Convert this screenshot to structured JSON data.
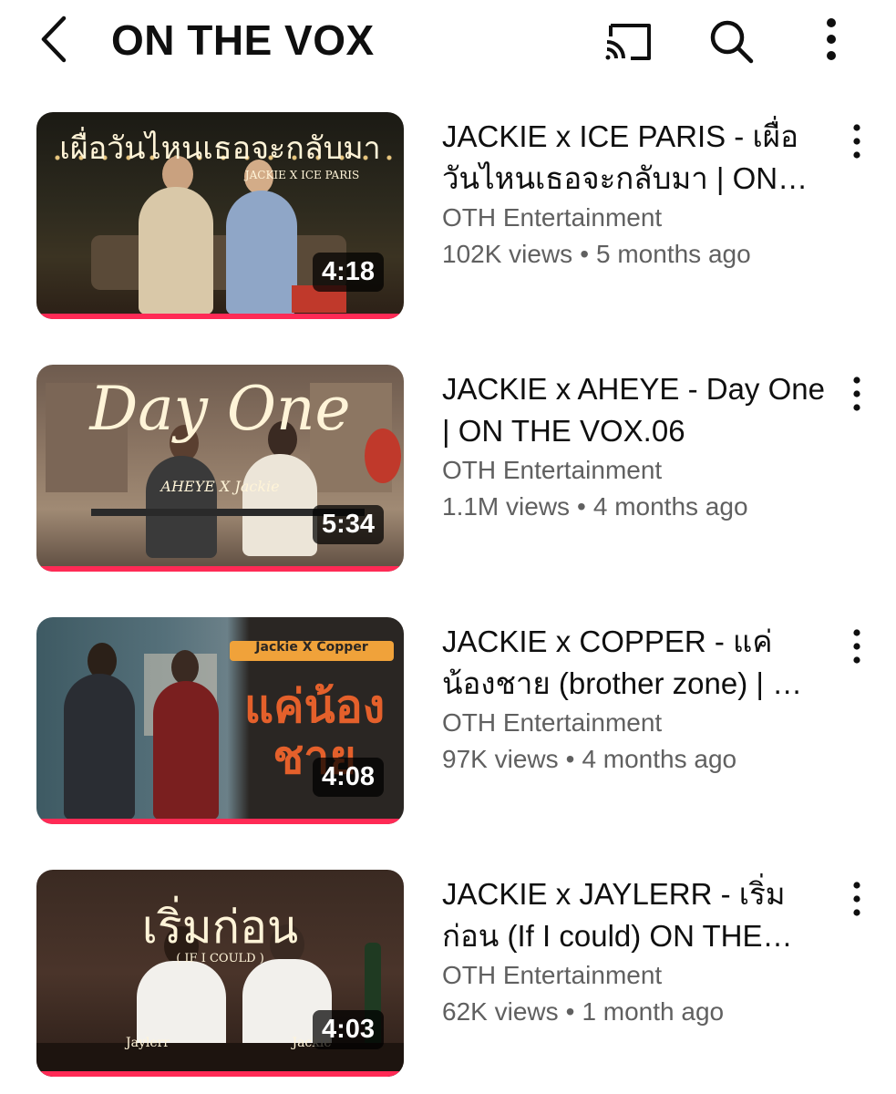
{
  "header": {
    "title": "ON THE VOX",
    "icons": [
      "back-icon",
      "cast-icon",
      "search-icon",
      "more-vert-icon"
    ]
  },
  "colors": {
    "progress": "#ff2a55",
    "secondary_text": "#606060"
  },
  "videos": [
    {
      "thumb_text": "เผื่อวันไหนเธอจะกลับมา",
      "thumb_sub": "JACKIE X ICE PARIS",
      "duration": "4:18",
      "watched": 1.0,
      "title": "JACKIE x ICE PARIS - เผื่อวันไหนเธอจะกลับมา | ON THE VOX",
      "channel": "OTH Entertainment",
      "views": "102K views",
      "age": "5 months ago"
    },
    {
      "thumb_text": "Day One",
      "thumb_sub": "AHEYE X Jackie",
      "duration": "5:34",
      "watched": 1.0,
      "title": "JACKIE x AHEYE - Day One | ON THE VOX.06",
      "channel": "OTH Entertainment",
      "views": "1.1M views",
      "age": "4 months ago"
    },
    {
      "thumb_text": "แค่น้องชาย",
      "thumb_sub": "Jackie X Copper",
      "duration": "4:08",
      "watched": 1.0,
      "title": "JACKIE x COPPER - แค่น้องชาย (brother zone) | ON THE VOX",
      "channel": "OTH Entertainment",
      "views": "97K views",
      "age": "4 months ago"
    },
    {
      "thumb_text": "เริ่มก่อน",
      "thumb_sub": "( IF I COULD )",
      "thumb_names": [
        "Jaylerr",
        "Jackie"
      ],
      "duration": "4:03",
      "watched": 1.0,
      "title": "JACKIE x JAYLERR - เริ่มก่อน (If I could) ON THE VOX",
      "channel": "OTH Entertainment",
      "views": "62K views",
      "age": "1 month ago"
    }
  ]
}
